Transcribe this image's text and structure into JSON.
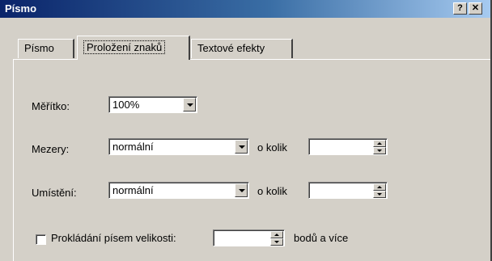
{
  "window": {
    "title": "Písmo",
    "help_label": "?",
    "close_label": "✕"
  },
  "tabs": [
    {
      "label": "Písmo",
      "active": false
    },
    {
      "label": "Proložení znaků",
      "active": true
    },
    {
      "label": "Textové efekty",
      "active": false
    }
  ],
  "form": {
    "scale": {
      "label": "Měřítko:",
      "value": "100%"
    },
    "spacing": {
      "label": "Mezery:",
      "value": "normální",
      "by_label": "o kolik",
      "by_value": ""
    },
    "position": {
      "label": "Umístění:",
      "value": "normální",
      "by_label": "o kolik",
      "by_value": ""
    },
    "kerning": {
      "label": "Prokládání písem velikosti:",
      "checked": false,
      "value": "",
      "suffix": "bodů a více"
    }
  },
  "icons": {
    "dropdown": "chevron-down-icon",
    "spin_up": "arrow-up-icon",
    "spin_down": "arrow-down-icon"
  },
  "colors": {
    "titlebar_start": "#0a246a",
    "titlebar_end": "#a6caf0",
    "face": "#d4d0c8"
  }
}
